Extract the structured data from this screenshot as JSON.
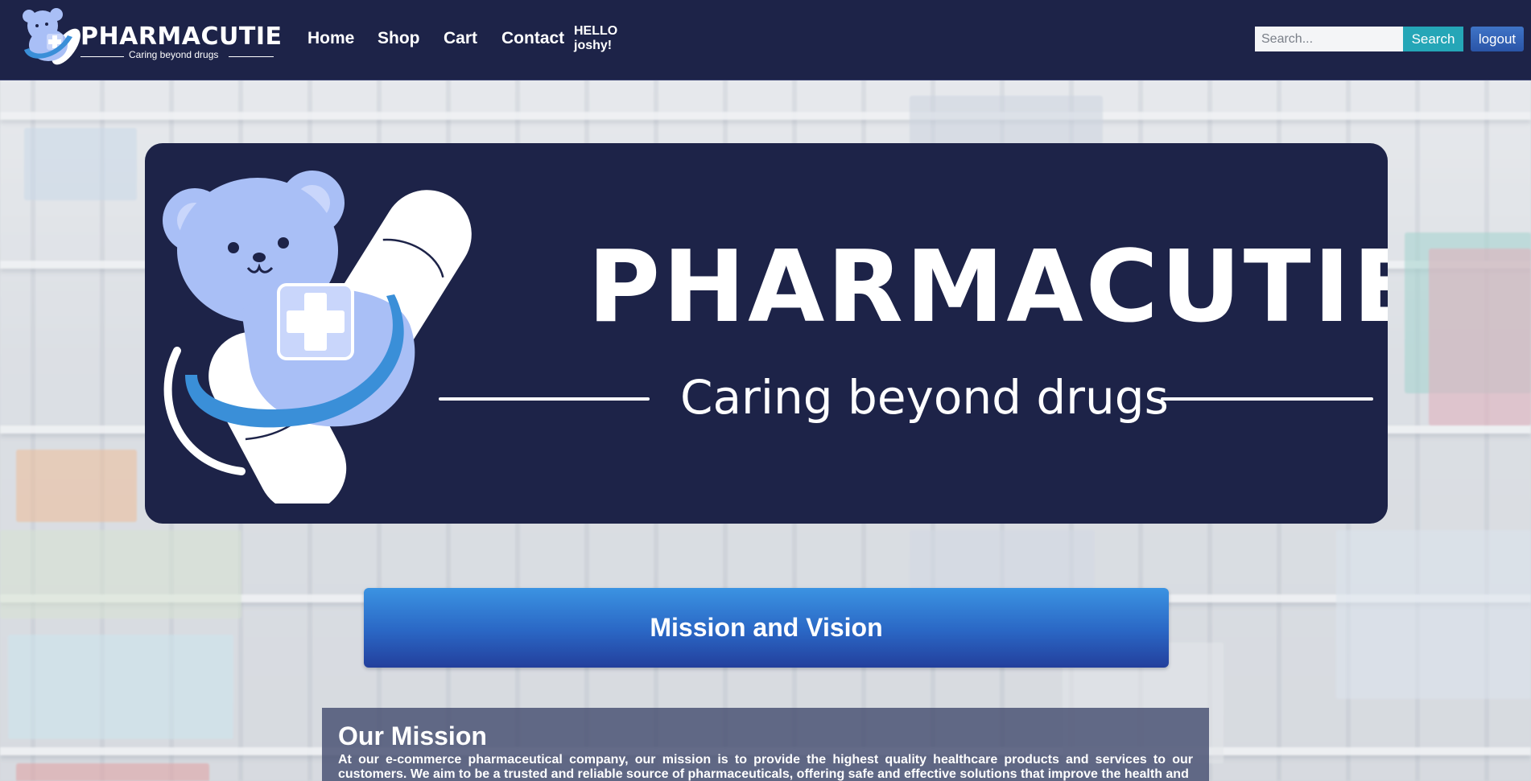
{
  "header": {
    "brand": {
      "name": "PHARMACUTIE",
      "tagline": "Caring beyond drugs"
    },
    "nav": [
      {
        "label": "Home"
      },
      {
        "label": "Shop"
      },
      {
        "label": "Cart"
      },
      {
        "label": "Contact"
      }
    ],
    "greeting": {
      "line1": "HELLO",
      "line2": "joshy!"
    },
    "search": {
      "placeholder": "Search...",
      "button_label": "Search"
    },
    "logout_label": "logout"
  },
  "hero": {
    "name": "PHARMACUTIE",
    "tagline": "Caring beyond drugs"
  },
  "mission_vision_button": "Mission and Vision",
  "mission": {
    "title": "Our Mission",
    "text": "At our e-commerce pharmaceutical company, our mission is to provide the highest quality healthcare products and services to our customers. We aim to be a trusted and reliable source of pharmaceuticals, offering safe and effective solutions that improve the health and"
  },
  "colors": {
    "navbar": "#1d2348",
    "hero_bg": "#1d2348",
    "search_button": "#25a6b7",
    "logout_button": "#2a55a8",
    "mascot": "#a9bff6",
    "mascot_band": "#3a8fd8",
    "mission_panel": "#464e70"
  }
}
